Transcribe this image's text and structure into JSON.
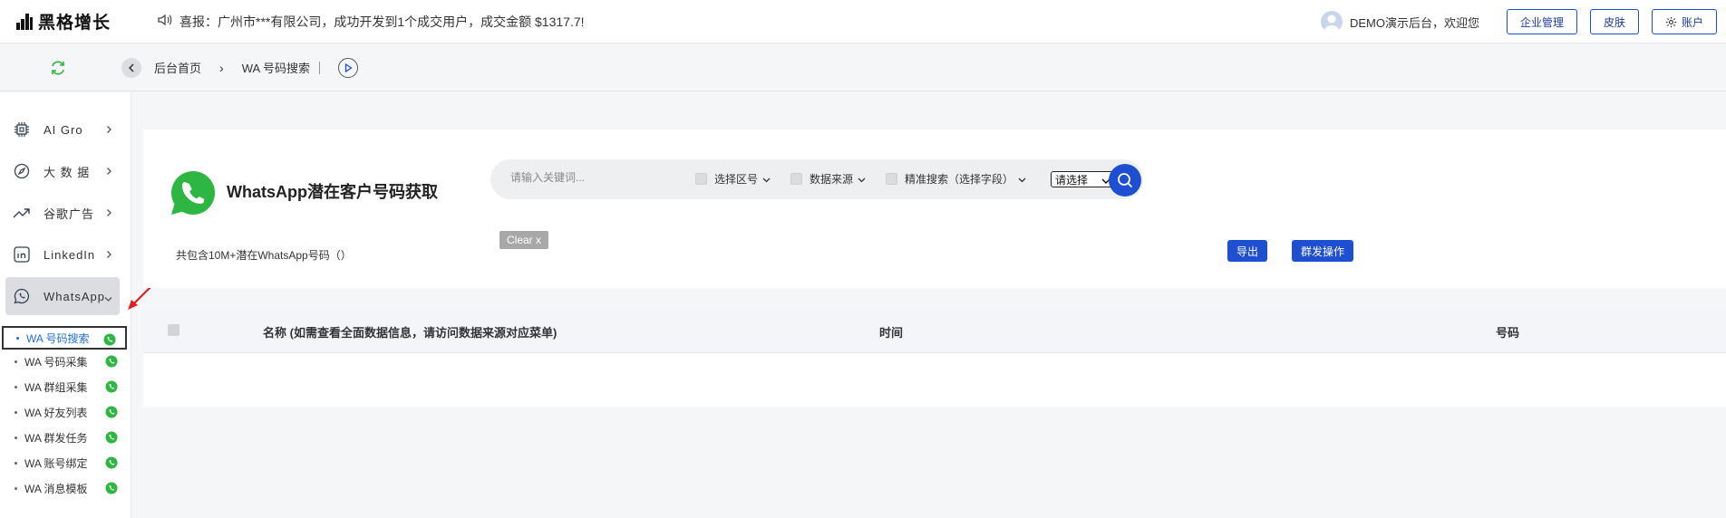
{
  "app": {
    "logo_text": "黑格增长",
    "notice": "喜报：广州市***有限公司，成功开发到1个成交用户，成交金额 $1317.7!"
  },
  "header": {
    "welcome": "DEMO演示后台，欢迎您",
    "buttons": {
      "enterprise": "企业管理",
      "skin": "皮肤",
      "account": "账户"
    }
  },
  "breadcrumb": {
    "home": "后台首页",
    "sep": "›",
    "current": "WA 号码搜索"
  },
  "sidebar": {
    "items": [
      {
        "label": "AI Gro",
        "icon": "chip-icon"
      },
      {
        "label": "大 数 据",
        "icon": "compass-icon"
      },
      {
        "label": "谷歌广告",
        "icon": "trend-icon"
      },
      {
        "label": "LinkedIn",
        "icon": "linkedin-icon"
      },
      {
        "label": "WhatsApp",
        "icon": "whatsapp-icon"
      }
    ],
    "subitems": [
      "WA 号码搜索",
      "WA 号码采集",
      "WA 群组采集",
      "WA 好友列表",
      "WA 群发任务",
      "WA 账号绑定",
      "WA 消息模板"
    ]
  },
  "main": {
    "title": "WhatsApp潜在客户号码获取",
    "subtitle": "共包含10M+潜在WhatsApp号码（）",
    "search": {
      "placeholder": "请输入关键词...",
      "filter_region": "选择区号",
      "filter_source": "数据来源",
      "filter_precise": "精准搜索（选择字段）",
      "select_value": "请选择"
    },
    "clear_label": "Clear x",
    "export_label": "导出",
    "bulk_label": "群发操作",
    "table": {
      "col_name": "名称 (如需查看全面数据信息，请访问数据来源对应菜单)",
      "col_time": "时间",
      "col_number": "号码"
    }
  },
  "colors": {
    "primary": "#1f4fd1",
    "whatsapp": "#2db742",
    "accent_red": "#e02020"
  }
}
